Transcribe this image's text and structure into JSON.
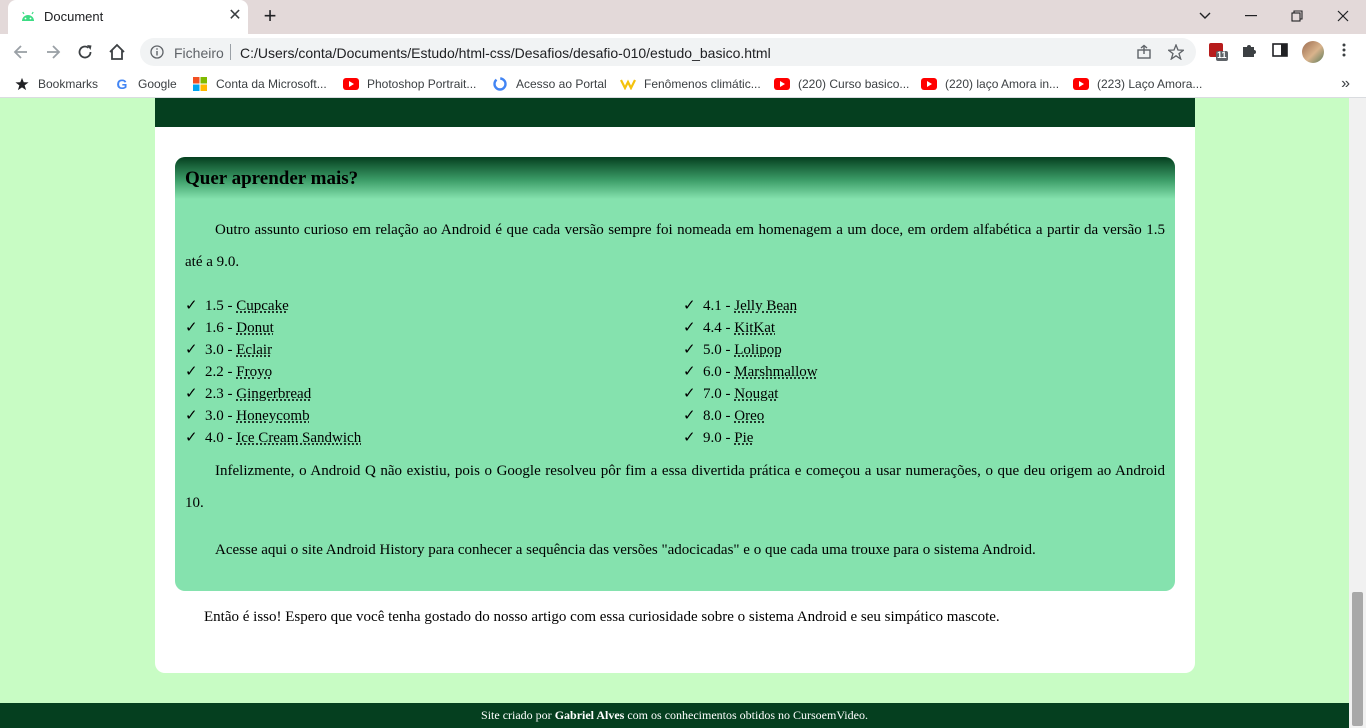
{
  "browser": {
    "tab_title": "Document",
    "omnibox": {
      "scheme_label": "Ficheiro",
      "url": "C:/Users/conta/Documents/Estudo/html-css/Desafios/desafio-010/estudo_basico.html"
    },
    "extension_badge": "11",
    "bookmarks": [
      {
        "label": "Bookmarks",
        "icon": "star-icon"
      },
      {
        "label": "Google",
        "icon": "google-icon"
      },
      {
        "label": "Conta da Microsoft...",
        "icon": "microsoft-icon"
      },
      {
        "label": "Photoshop Portrait...",
        "icon": "youtube-icon"
      },
      {
        "label": "Acesso ao Portal",
        "icon": "portal-icon"
      },
      {
        "label": "Fenômenos climátic...",
        "icon": "weather-icon"
      },
      {
        "label": "(220) Curso basico...",
        "icon": "youtube-icon"
      },
      {
        "label": "(220) laço Amora in...",
        "icon": "youtube-icon"
      },
      {
        "label": "(223) Laço Amora...",
        "icon": "youtube-icon"
      }
    ],
    "bookmarks_more": "»"
  },
  "page": {
    "box": {
      "title": "Quer aprender mais?",
      "intro": "Outro assunto curioso em relação ao Android é que cada versão sempre foi nomeada em homenagem a um doce, em ordem alfabética a partir da versão 1.5 até a 9.0.",
      "check_symbol": "✓",
      "versions_left": [
        {
          "number": "1.5",
          "name": "Cupcake"
        },
        {
          "number": "1.6",
          "name": "Donut"
        },
        {
          "number": "3.0",
          "name": "Eclair"
        },
        {
          "number": "2.2",
          "name": "Froyo"
        },
        {
          "number": "2.3",
          "name": "Gingerbread"
        },
        {
          "number": "3.0",
          "name": "Honeycomb"
        },
        {
          "number": "4.0",
          "name": "Ice Cream Sandwich"
        }
      ],
      "versions_right": [
        {
          "number": "4.1",
          "name": "Jelly Bean"
        },
        {
          "number": "4.4",
          "name": "KitKat"
        },
        {
          "number": "5.0",
          "name": "Lolipop"
        },
        {
          "number": "6.0",
          "name": "Marshmallow"
        },
        {
          "number": "7.0",
          "name": "Nougat"
        },
        {
          "number": "8.0",
          "name": "Oreo"
        },
        {
          "number": "9.0",
          "name": "Pie"
        }
      ],
      "para_q": "Infelizmente, o Android Q não existiu, pois o Google resolveu pôr fim a essa divertida prática e começou a usar numerações, o que deu origem ao Android 10.",
      "para_history": "Acesse aqui o site Android History para conhecer a sequência das versões \"adocicadas\" e o que cada uma trouxe para o sistema Android."
    },
    "closing": "Então é isso! Espero que você tenha gostado do nosso artigo com essa curiosidade sobre o sistema Android e seu simpático mascote.",
    "footer": {
      "prefix": "Site criado por ",
      "author": "Gabriel Alves",
      "suffix": " com os conhecimentos obtidos no CursoemVideo."
    }
  },
  "colors": {
    "page_bg": "#c8fcc4",
    "dark_green": "#053f1f",
    "box_green": "#85e2ae"
  }
}
